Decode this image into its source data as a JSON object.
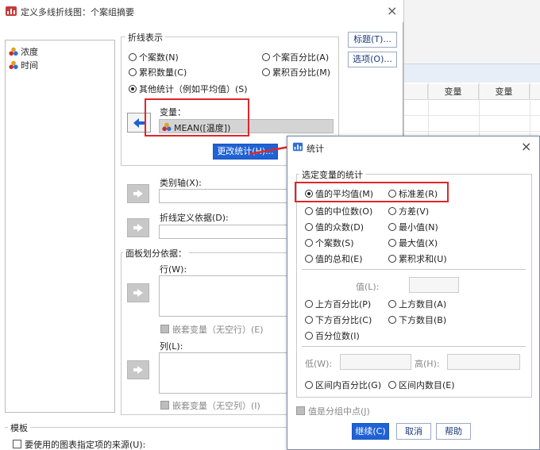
{
  "main_dialog": {
    "title": "定义多线折线图：个案组摘要",
    "close": "×",
    "variables": [
      {
        "label": "浓度"
      },
      {
        "label": "时间"
      }
    ],
    "buttons": {
      "title_btn": "标题(T)...",
      "options_btn": "选项(O)...",
      "change_stat_btn": "更改统计(H)..."
    },
    "line_repr": {
      "title": "折线表示",
      "options": [
        {
          "label": "个案数(N)",
          "selected": false
        },
        {
          "label": "个案百分比(A)",
          "selected": false
        },
        {
          "label": "累积数量(C)",
          "selected": false
        },
        {
          "label": "累积百分比(M)",
          "selected": false
        },
        {
          "label": "其他统计（例如平均值）(S)",
          "selected": true
        }
      ],
      "variable_label": "变量：",
      "variable_value": "MEAN([温度])"
    },
    "category_axis_label": "类别轴(X):",
    "line_define_label": "折线定义依据(D):",
    "panel": {
      "title": "面板划分依据：",
      "row_label": "行(W):",
      "row_nest_label": "嵌套变量（无空行）(E)",
      "col_label": "列(L):",
      "col_nest_label": "嵌套变量（无空列）(I)"
    },
    "template": {
      "title": "模板",
      "checkbox_label": "要使用的图表指定项的来源(U):"
    }
  },
  "background_sheet": {
    "col_headers": [
      "变量",
      "变量"
    ]
  },
  "stat_dialog": {
    "title": "统计",
    "close": "×",
    "group_title": "选定变量的统计",
    "options": [
      {
        "label": "值的平均值(M)",
        "selected": true
      },
      {
        "label": "标准差(R)",
        "selected": false
      },
      {
        "label": "值的中位数(O)",
        "selected": false
      },
      {
        "label": "方差(V)",
        "selected": false
      },
      {
        "label": "值的众数(D)",
        "selected": false
      },
      {
        "label": "最小值(N)",
        "selected": false
      },
      {
        "label": "个案数(S)",
        "selected": false
      },
      {
        "label": "最大值(X)",
        "selected": false
      },
      {
        "label": "值的总和(E)",
        "selected": false
      },
      {
        "label": "累积求和(U)",
        "selected": false
      }
    ],
    "value_label": "值(L):",
    "percent_options": [
      {
        "label": "上方百分比(P)"
      },
      {
        "label": "上方数目(A)"
      },
      {
        "label": "下方百分比(C)"
      },
      {
        "label": "下方数目(B)"
      },
      {
        "label": "百分位数(I)"
      }
    ],
    "low_label": "低(W):",
    "high_label": "高(H):",
    "range_options": [
      {
        "label": "区间内百分比(G)"
      },
      {
        "label": "区间内数目(E)"
      }
    ],
    "midpoint_label": "值是分组中点(J)",
    "buttons": {
      "continue": "继续(C)",
      "cancel": "取消",
      "help": "帮助"
    }
  },
  "colors": {
    "accent": "#1f62d6",
    "highlight_red": "#e0262a"
  }
}
